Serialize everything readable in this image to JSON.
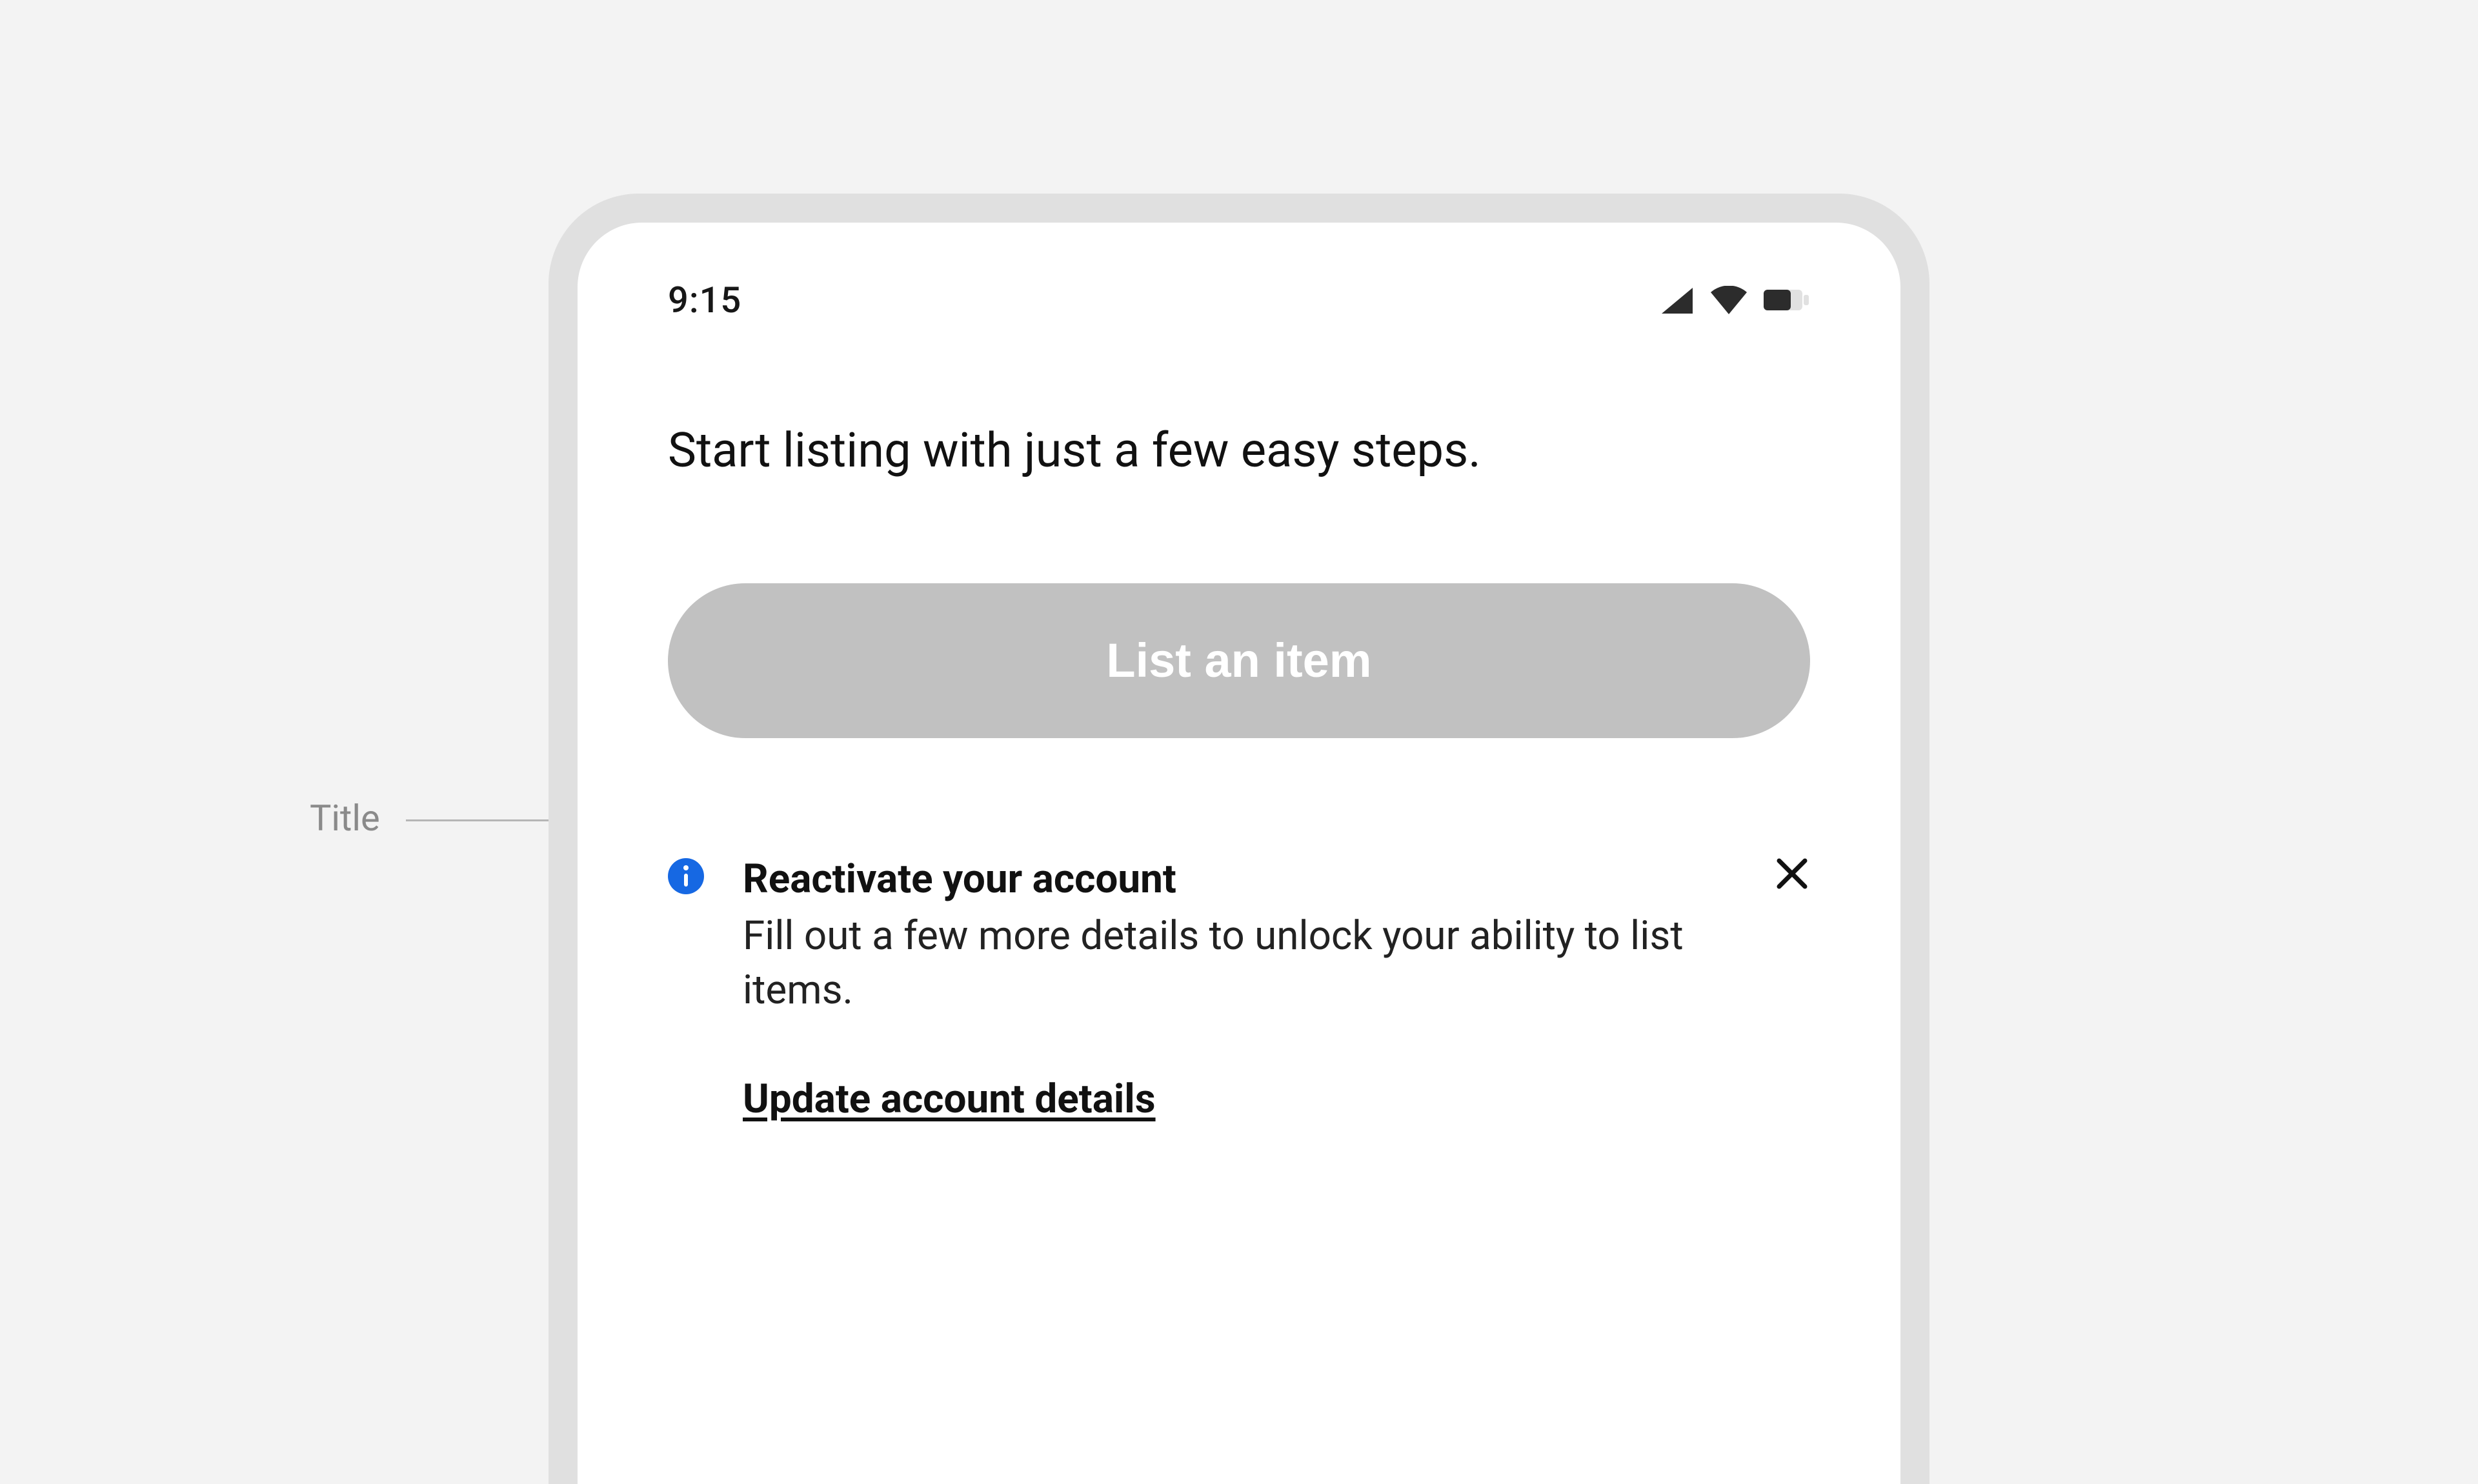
{
  "statusBar": {
    "time": "9:15"
  },
  "page": {
    "heading": "Start listing with just a few easy steps.",
    "ctaLabel": "List an item"
  },
  "notice": {
    "title": "Reactivate your account",
    "description": "Fill out a few more details to unlock your ability to list items.",
    "linkLabel": "Update account details",
    "iconName": "info-icon",
    "accentColor": "#1668e3"
  },
  "annotation": {
    "label": "Title"
  }
}
